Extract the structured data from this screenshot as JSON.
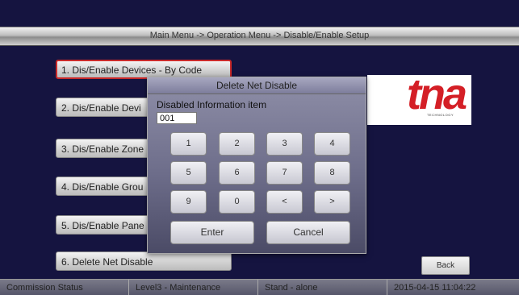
{
  "header": {
    "breadcrumb": "Main Menu -> Operation Menu -> Disable/Enable Setup"
  },
  "menu": {
    "items": [
      {
        "label": "1. Dis/Enable Devices - By Code",
        "selected": true
      },
      {
        "label": "2. Dis/Enable Devi"
      },
      {
        "label": "3. Dis/Enable Zone"
      },
      {
        "label": "4. Dis/Enable Grou"
      },
      {
        "label": "5. Dis/Enable Pane"
      },
      {
        "label": "6. Delete Net Disable"
      }
    ]
  },
  "logo": {
    "text": "tna",
    "subtitle": "TECHNOLOGY",
    "color": "#d41f26"
  },
  "dialog": {
    "title": "Delete Net Disable",
    "label": "Disabled Information item",
    "input_value": "001",
    "keys": [
      "1",
      "2",
      "3",
      "4",
      "5",
      "6",
      "7",
      "8",
      "9",
      "0",
      "<",
      ">"
    ],
    "enter_label": "Enter",
    "cancel_label": "Cancel"
  },
  "back_label": "Back",
  "status": {
    "commission": "Commission Status",
    "level": "Level3 - Maintenance",
    "mode": "Stand - alone",
    "datetime": "2015-04-15 11:04:22"
  },
  "colors": {
    "background": "#151440",
    "accent_border": "#c92a2a"
  }
}
